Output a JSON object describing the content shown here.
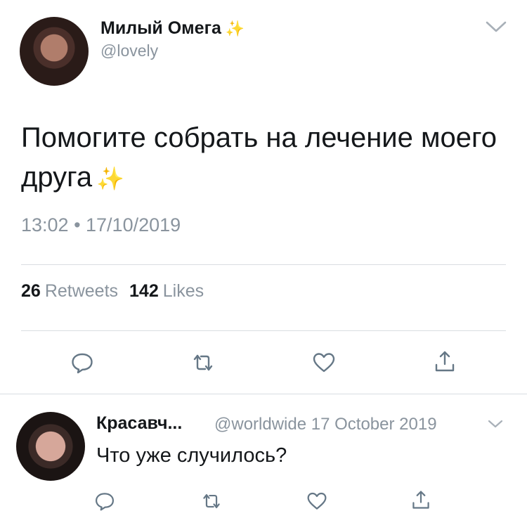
{
  "main_tweet": {
    "display_name": "Милый Омега",
    "handle": "@lovely",
    "text": "Помогите собрать на лечение моего друга",
    "timestamp": "13:02 • 17/10/2019",
    "retweets_count": "26",
    "retweets_label": "Retweets",
    "likes_count": "142",
    "likes_label": "Likes"
  },
  "reply": {
    "display_name": "Красавч...",
    "handle_and_date": "@worldwide 17 October 2019",
    "text": "Что уже случилось?"
  },
  "icons": {
    "sparkle": "sparkles-icon",
    "chevron": "chevron-down-icon",
    "reply": "reply-icon",
    "retweet": "retweet-icon",
    "like": "heart-icon",
    "share": "share-icon"
  },
  "colors": {
    "primary_text": "#14171a",
    "secondary_text": "#8a949e",
    "sparkle": "#f5c518"
  }
}
